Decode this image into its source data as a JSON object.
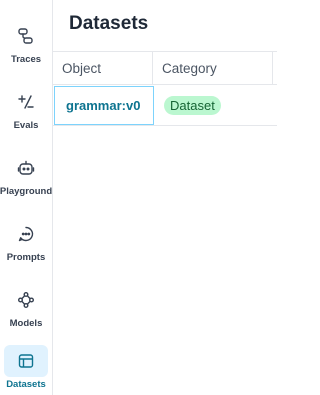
{
  "sidebar": {
    "items": [
      {
        "label": "Traces",
        "icon": "traces-icon"
      },
      {
        "label": "Evals",
        "icon": "evals-icon"
      },
      {
        "label": "Playground",
        "icon": "playground-icon"
      },
      {
        "label": "Prompts",
        "icon": "prompts-icon"
      },
      {
        "label": "Models",
        "icon": "models-icon"
      },
      {
        "label": "Datasets",
        "icon": "datasets-icon",
        "active": true
      }
    ]
  },
  "main": {
    "title": "Datasets",
    "table": {
      "columns": [
        "Object",
        "Category"
      ],
      "rows": [
        {
          "object": "grammar:v0",
          "category": "Dataset"
        }
      ]
    }
  },
  "colors": {
    "accent": "#0e7490",
    "active_bg": "#e0f2fe",
    "badge_bg": "#bbf7d0",
    "badge_text": "#166534"
  }
}
